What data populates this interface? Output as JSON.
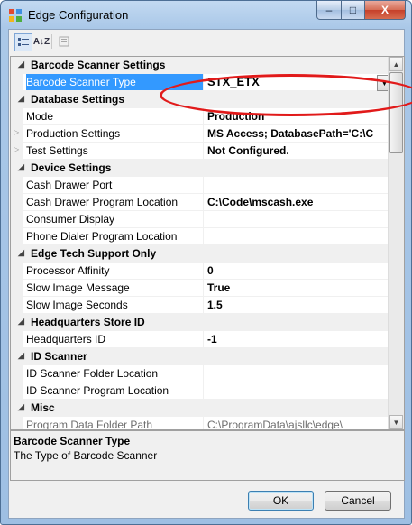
{
  "window": {
    "title": "Edge Configuration",
    "minimize_glyph": "‒",
    "maximize_glyph": "□",
    "close_glyph": "X"
  },
  "toolbar": {
    "categorized_icon": "categorized-view-icon",
    "alphabetical_label": "A↓Z",
    "property_pages_icon": "property-pages-icon"
  },
  "property_grid": {
    "rows": [
      {
        "type": "category",
        "label": "Barcode Scanner Settings"
      },
      {
        "type": "property",
        "name": "Barcode Scanner Type",
        "value": "STX_ETX"
      },
      {
        "type": "category",
        "label": "Database Settings"
      },
      {
        "type": "property",
        "name": "Mode",
        "value": "Production"
      },
      {
        "type": "property",
        "name": "Production Settings",
        "value": "MS Access; DatabasePath='C:\\C"
      },
      {
        "type": "property",
        "name": "Test Settings",
        "value": "Not Configured."
      },
      {
        "type": "category",
        "label": "Device Settings"
      },
      {
        "type": "property",
        "name": "Cash Drawer Port",
        "value": ""
      },
      {
        "type": "property",
        "name": "Cash Drawer Program Location",
        "value": "C:\\Code\\mscash.exe"
      },
      {
        "type": "property",
        "name": "Consumer Display",
        "value": ""
      },
      {
        "type": "property",
        "name": "Phone Dialer Program Location",
        "value": ""
      },
      {
        "type": "category",
        "label": "Edge Tech Support Only"
      },
      {
        "type": "property",
        "name": "Processor Affinity",
        "value": "0"
      },
      {
        "type": "property",
        "name": "Slow Image Message",
        "value": "True"
      },
      {
        "type": "property",
        "name": "Slow Image Seconds",
        "value": "1.5"
      },
      {
        "type": "category",
        "label": "Headquarters Store ID"
      },
      {
        "type": "property",
        "name": "Headquarters ID",
        "value": "-1"
      },
      {
        "type": "category",
        "label": "ID Scanner"
      },
      {
        "type": "property",
        "name": "ID Scanner Folder Location",
        "value": ""
      },
      {
        "type": "property",
        "name": "ID Scanner Program Location",
        "value": ""
      },
      {
        "type": "category",
        "label": "Misc"
      },
      {
        "type": "property",
        "name": "Program Data Folder Path",
        "value": "C:\\ProgramData\\ajsllc\\edge\\"
      }
    ],
    "selected_index": 1,
    "expandable_rows": [
      4,
      5
    ],
    "dim_rows": [
      21
    ],
    "collapse_glyph": "◢",
    "expand_glyph": "▷",
    "dropdown_glyph": "▼"
  },
  "description": {
    "title": "Barcode Scanner Type",
    "text": "The Type of Barcode Scanner"
  },
  "buttons": {
    "ok_label": "OK",
    "cancel_label": "Cancel"
  },
  "annotation": {
    "color": "#e11a1a"
  }
}
